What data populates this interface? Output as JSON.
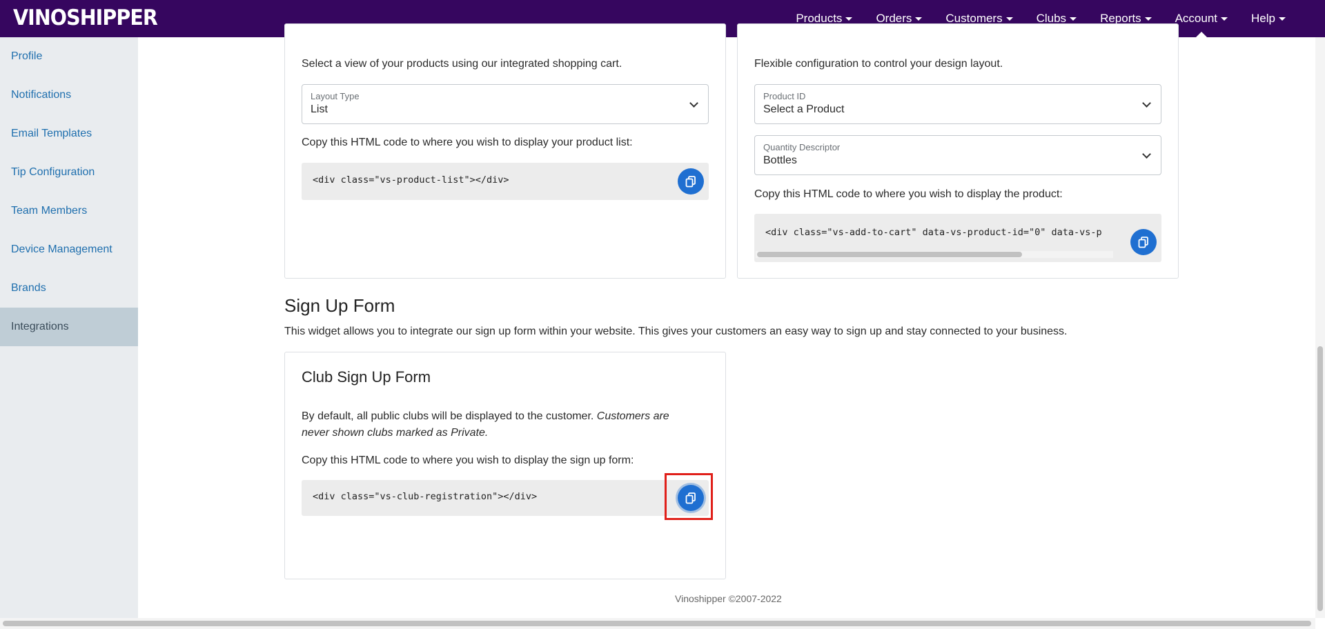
{
  "brand": {
    "logo_text": "VINOSHIPPER",
    "bar_color": "#36065f"
  },
  "nav": {
    "items": [
      {
        "label": "Products"
      },
      {
        "label": "Orders"
      },
      {
        "label": "Customers"
      },
      {
        "label": "Clubs"
      },
      {
        "label": "Reports"
      },
      {
        "label": "Account",
        "active": true
      },
      {
        "label": "Help"
      }
    ]
  },
  "sidebar": {
    "items": [
      {
        "label": "Profile"
      },
      {
        "label": "Notifications"
      },
      {
        "label": "Email Templates"
      },
      {
        "label": "Tip Configuration"
      },
      {
        "label": "Team Members"
      },
      {
        "label": "Device Management"
      },
      {
        "label": "Brands"
      },
      {
        "label": "Integrations",
        "active": true
      }
    ]
  },
  "product_list_card": {
    "description": "Select a view of your products using our integrated shopping cart.",
    "layout_select": {
      "label": "Layout Type",
      "value": "List"
    },
    "copy_instructions": "Copy this HTML code to where you wish to display your product list:",
    "code": "<div class=\"vs-product-list\"></div>"
  },
  "add_to_cart_card": {
    "description": "Flexible configuration to control your design layout.",
    "product_select": {
      "label": "Product ID",
      "value": "Select a Product"
    },
    "quantity_select": {
      "label": "Quantity Descriptor",
      "value": "Bottles"
    },
    "copy_instructions": "Copy this HTML code to where you wish to display the product:",
    "code": "<div class=\"vs-add-to-cart\" data-vs-product-id=\"0\" data-vs-p"
  },
  "signup_section": {
    "title": "Sign Up Form",
    "description": "This widget allows you to integrate our sign up form within your website. This gives your customers an easy way to sign up and stay connected to your business."
  },
  "club_signup_card": {
    "title": "Club Sign Up Form",
    "desc_plain": "By default, all public clubs will be displayed to the customer. ",
    "desc_italic_1": "Customers are",
    "desc_italic_2": "never shown clubs marked as Private.",
    "copy_instructions": "Copy this HTML code to where you wish to display the sign up form:",
    "code": "<div class=\"vs-club-registration\"></div>"
  },
  "footer": {
    "text": "Vinoshipper ©2007-2022"
  },
  "colors": {
    "accent": "#1f6fd1",
    "highlight": "#e0201a",
    "sidebar_link": "#1f6fae"
  }
}
